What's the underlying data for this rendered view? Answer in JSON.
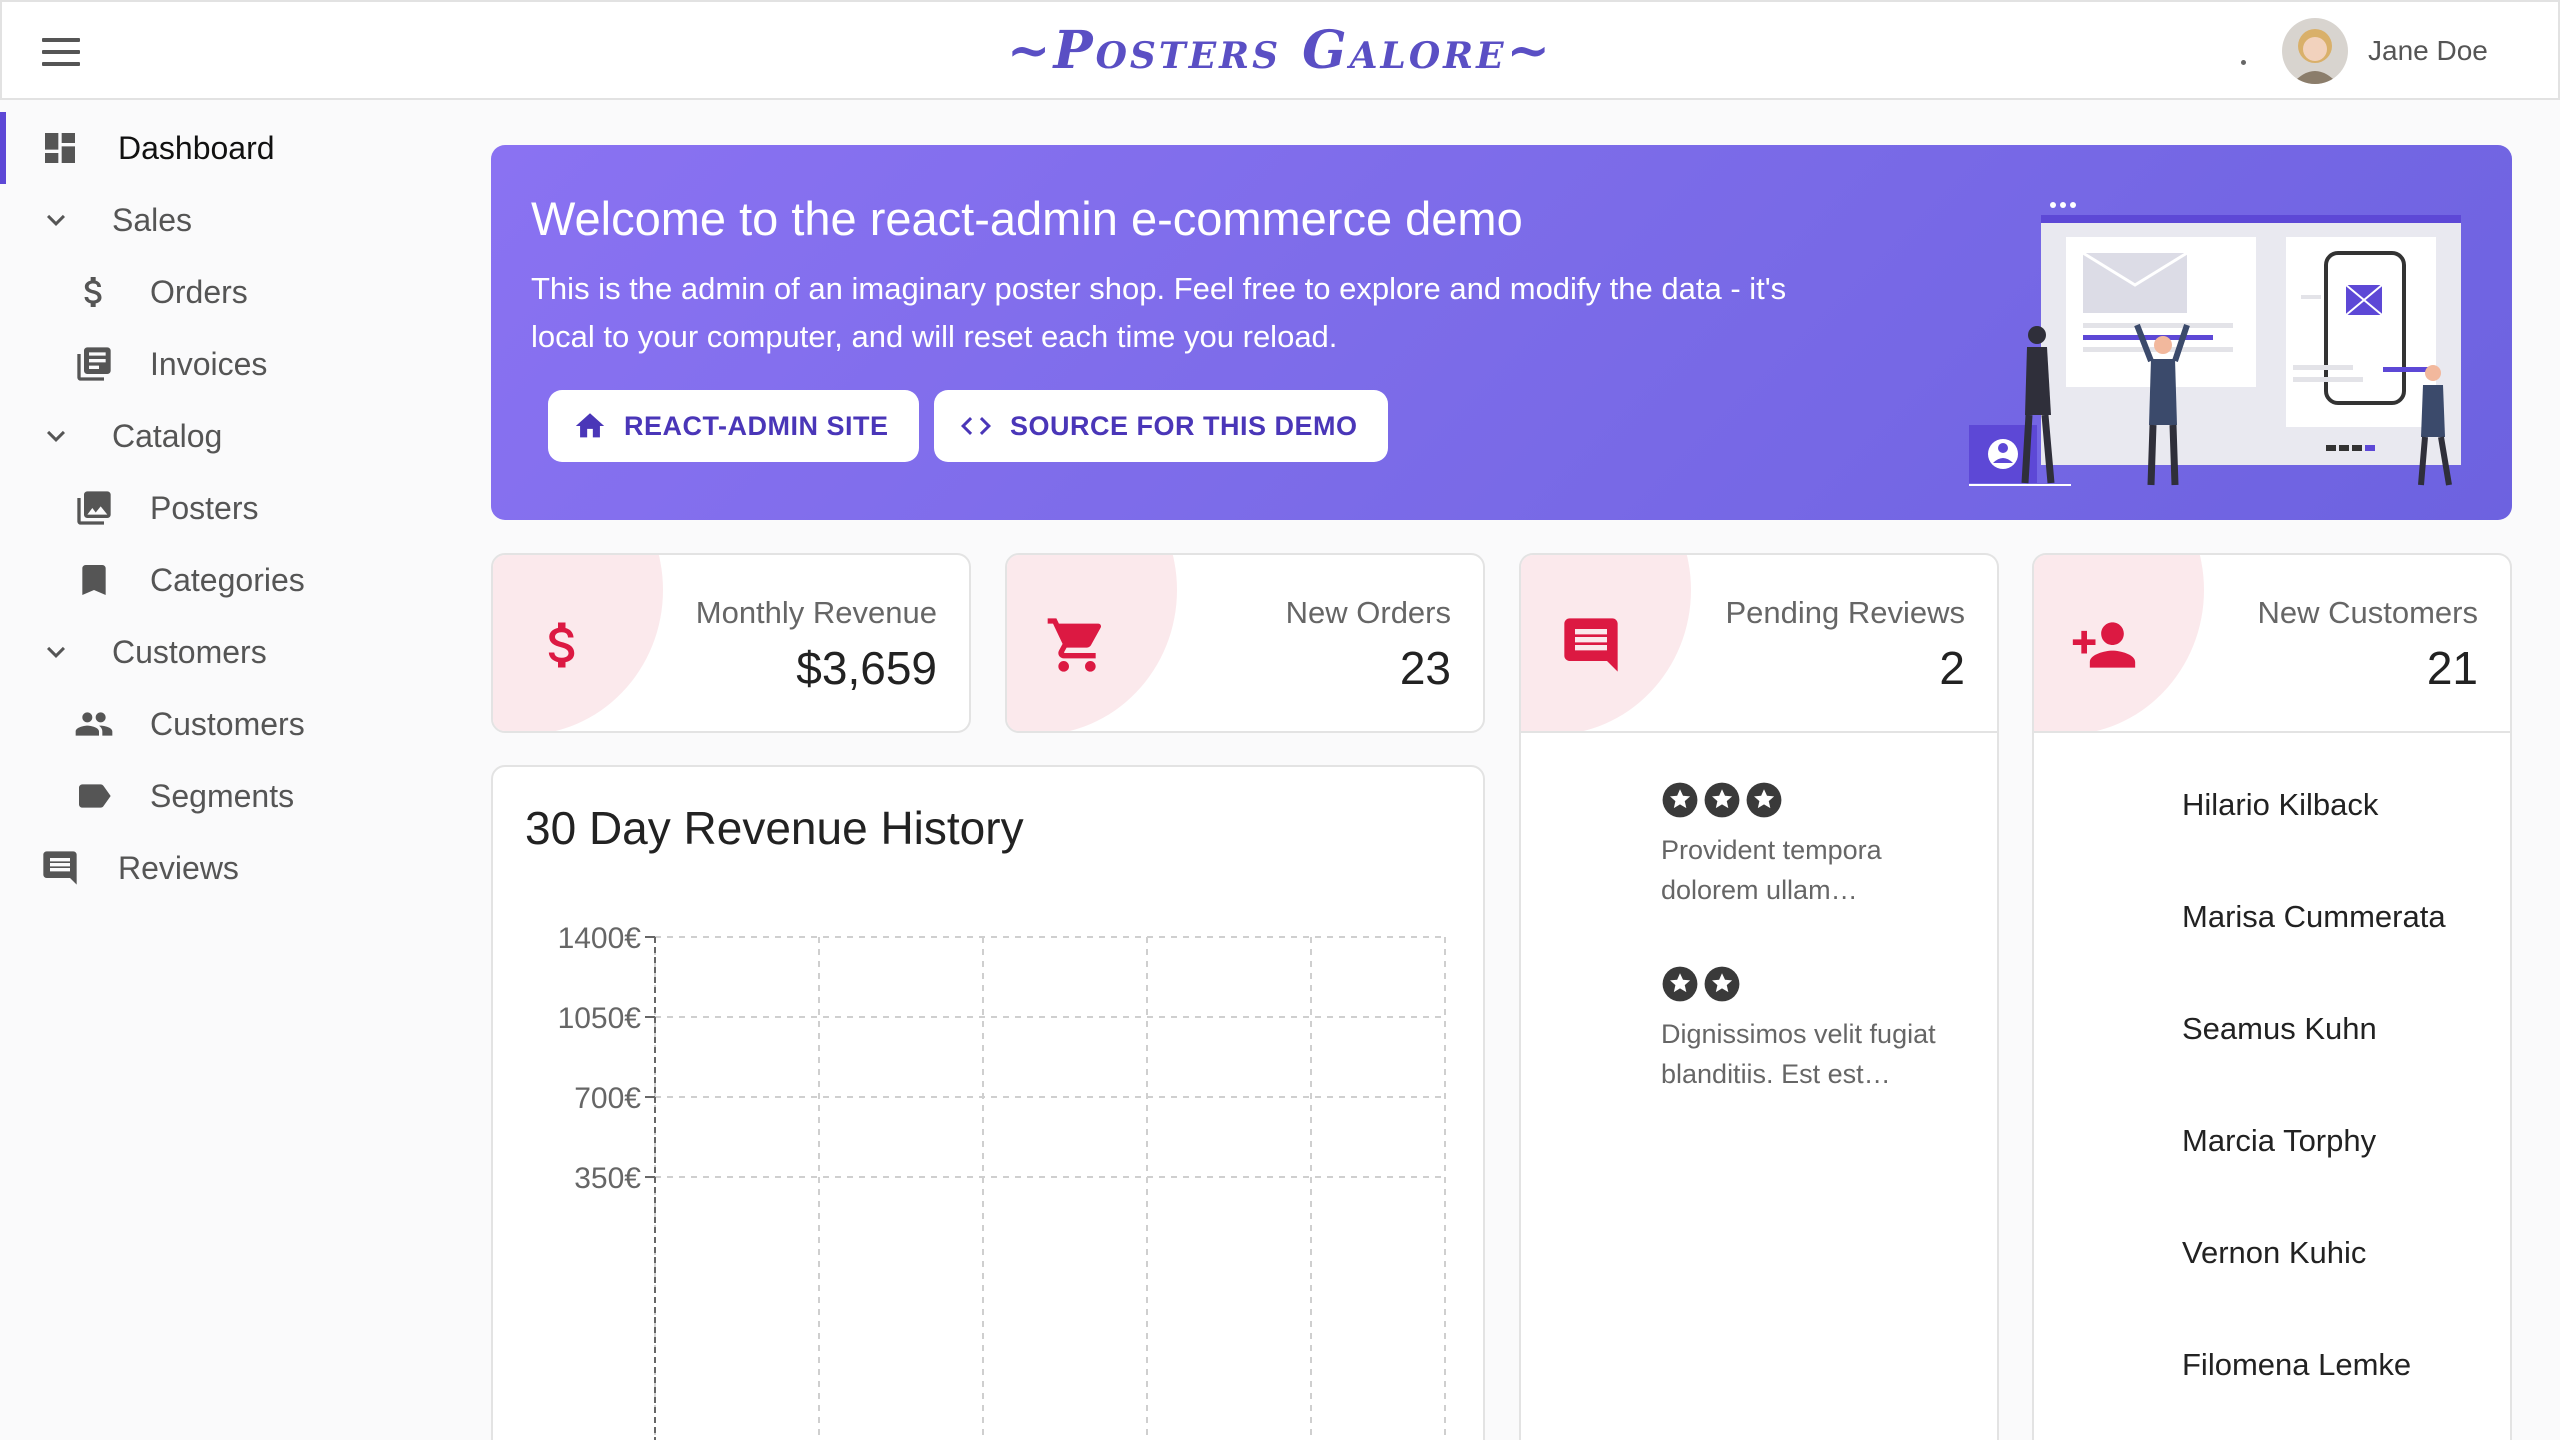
{
  "app": {
    "title": "~Posters Galore~",
    "user_name": "Jane Doe"
  },
  "sidebar": {
    "items": [
      {
        "label": "Dashboard",
        "icon": "dashboard-icon"
      },
      {
        "label": "Sales",
        "icon": "chevron-down-icon"
      },
      {
        "label": "Orders",
        "icon": "dollar-icon"
      },
      {
        "label": "Invoices",
        "icon": "invoice-icon"
      },
      {
        "label": "Catalog",
        "icon": "chevron-down-icon"
      },
      {
        "label": "Posters",
        "icon": "image-collection-icon"
      },
      {
        "label": "Categories",
        "icon": "bookmark-icon"
      },
      {
        "label": "Customers",
        "icon": "chevron-down-icon"
      },
      {
        "label": "Customers",
        "icon": "people-icon"
      },
      {
        "label": "Segments",
        "icon": "label-icon"
      },
      {
        "label": "Reviews",
        "icon": "comment-icon"
      }
    ]
  },
  "welcome": {
    "title": "Welcome to the react-admin e-commerce demo",
    "text": "This is the admin of an imaginary poster shop. Feel free to explore and modify the data - it's local to your computer, and will reset each time you reload.",
    "button_site": "REACT-ADMIN SITE",
    "button_source": "SOURCE FOR THIS DEMO"
  },
  "stats": [
    {
      "label": "Monthly Revenue",
      "value": "$3,659",
      "icon": "dollar-icon"
    },
    {
      "label": "New Orders",
      "value": "23",
      "icon": "shopping-cart-icon"
    },
    {
      "label": "Pending Reviews",
      "value": "2",
      "icon": "comment-icon"
    },
    {
      "label": "New Customers",
      "value": "21",
      "icon": "person-add-icon"
    }
  ],
  "reviews": [
    {
      "stars": 3,
      "text": "Provident tempora dolorem ullam…"
    },
    {
      "stars": 2,
      "text": "Dignissimos velit fugiat blanditiis. Est est…"
    }
  ],
  "customers": [
    "Hilario Kilback",
    "Marisa Cummerata",
    "Seamus Kuhn",
    "Marcia Torphy",
    "Vernon Kuhic",
    "Filomena Lemke"
  ],
  "colors": {
    "accent": "#5d48d6",
    "stat_icon": "#dc1942",
    "banner": "#7b6be8"
  },
  "chart_data": {
    "type": "area",
    "title": "30 Day Revenue History",
    "yticks": [
      "1400€",
      "1050€",
      "700€",
      "350€"
    ],
    "ytick_values": [
      1400,
      1050,
      700,
      350
    ],
    "ylim": [
      0,
      1400
    ],
    "grid": true,
    "series": []
  }
}
